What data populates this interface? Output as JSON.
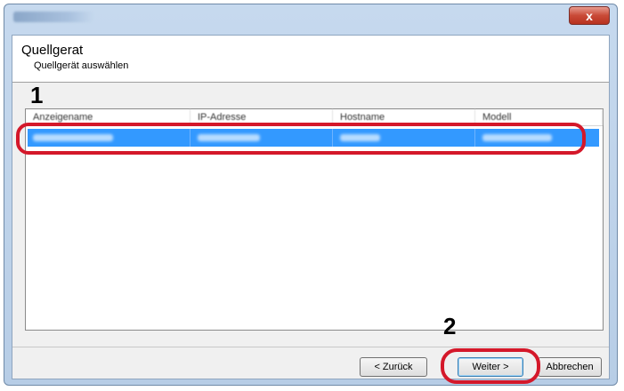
{
  "window": {
    "close_glyph": "x"
  },
  "header": {
    "title": "Quellgerat",
    "subtitle": "Quellgerät auswählen"
  },
  "markers": {
    "one": "1",
    "two": "2"
  },
  "list": {
    "columns": [
      "Anzeigename",
      "IP-Adresse",
      "Hostname",
      "Modell"
    ],
    "rows": [
      {
        "selected": true,
        "cells_obscured": true
      }
    ]
  },
  "buttons": {
    "back": "< Zurück",
    "next": "Weiter >",
    "cancel": "Abbrechen"
  },
  "colors": {
    "selection": "#3399ff",
    "annotation": "#d4182a"
  }
}
